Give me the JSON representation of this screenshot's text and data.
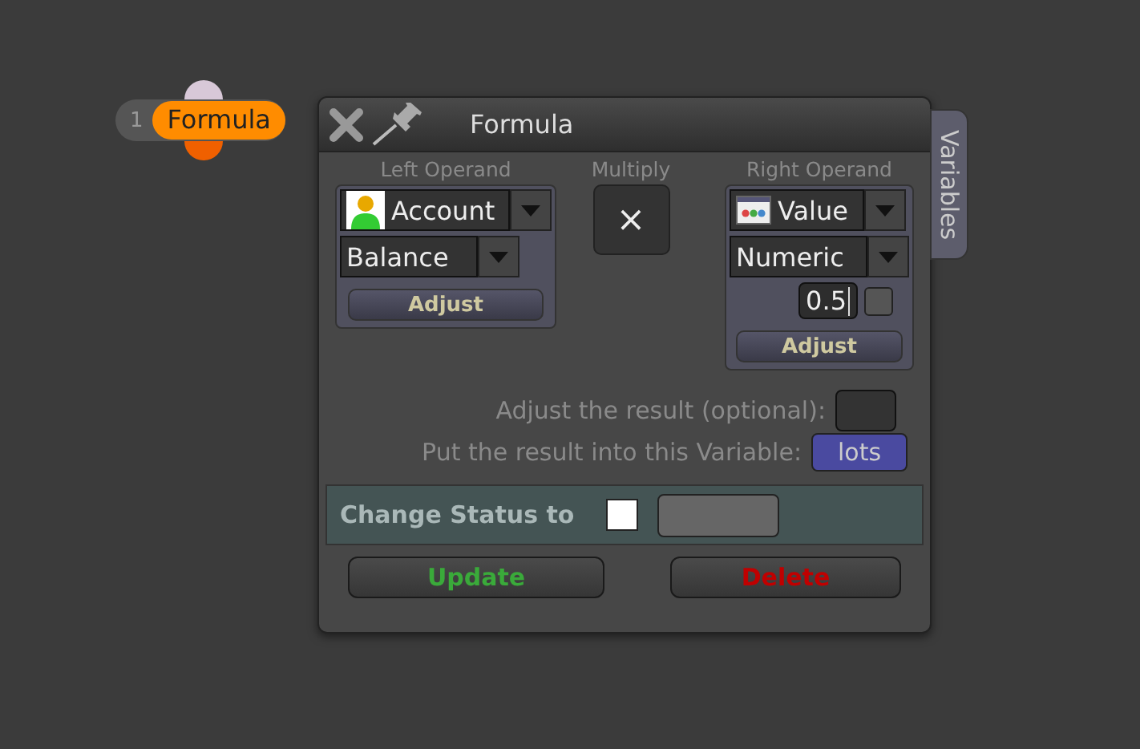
{
  "node": {
    "number": "1",
    "label": "Formula"
  },
  "dialog": {
    "title": "Formula",
    "side_tab": "Variables",
    "left_operand": {
      "heading": "Left Operand",
      "source": "Account",
      "field": "Balance",
      "adjust": "Adjust"
    },
    "operation": {
      "heading": "Multiply",
      "symbol": "×"
    },
    "right_operand": {
      "heading": "Right Operand",
      "source": "Value",
      "type": "Numeric",
      "value": "0.5",
      "toggle_checked": false,
      "adjust": "Adjust"
    },
    "adjust_result": {
      "label": "Adjust the result (optional):"
    },
    "result_variable": {
      "label": "Put the result into this Variable:",
      "value": "lots"
    },
    "status": {
      "label": "Change Status to",
      "checked": false
    },
    "buttons": [
      {
        "label": "Update",
        "kind": "confirm"
      },
      {
        "label": "Delete",
        "kind": "danger"
      }
    ]
  }
}
